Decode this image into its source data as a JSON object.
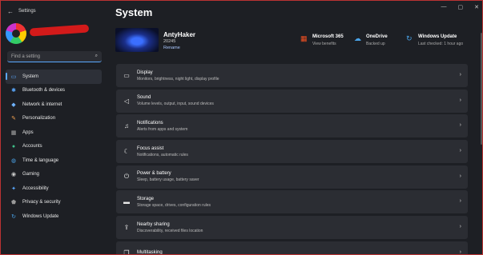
{
  "window": {
    "title": "Settings"
  },
  "sidebar": {
    "search_placeholder": "Find a setting",
    "items": [
      {
        "label": "System",
        "icon": "monitor-icon",
        "glyph": "▭",
        "color": "#5aa9ff",
        "active": true
      },
      {
        "label": "Bluetooth & devices",
        "icon": "bluetooth-icon",
        "glyph": "✱",
        "color": "#5aa9ff"
      },
      {
        "label": "Network & internet",
        "icon": "network-icon",
        "glyph": "◆",
        "color": "#6fb3ff"
      },
      {
        "label": "Personalization",
        "icon": "brush-icon",
        "glyph": "✎",
        "color": "#f0a050"
      },
      {
        "label": "Apps",
        "icon": "apps-icon",
        "glyph": "▦",
        "color": "#aaa"
      },
      {
        "label": "Accounts",
        "icon": "person-icon",
        "glyph": "●",
        "color": "#3fc08a"
      },
      {
        "label": "Time & language",
        "icon": "globe-icon",
        "glyph": "◍",
        "color": "#4aa3e8"
      },
      {
        "label": "Gaming",
        "icon": "gamepad-icon",
        "glyph": "◉",
        "color": "#ccc"
      },
      {
        "label": "Accessibility",
        "icon": "accessibility-icon",
        "glyph": "✦",
        "color": "#5aa9ff"
      },
      {
        "label": "Privacy & security",
        "icon": "shield-icon",
        "glyph": "⬟",
        "color": "#999"
      },
      {
        "label": "Windows Update",
        "icon": "update-icon",
        "glyph": "↻",
        "color": "#4aa3e8"
      }
    ]
  },
  "main": {
    "title": "System",
    "device": {
      "name": "AntyHaker",
      "sub": "20245",
      "rename": "Rename"
    },
    "status": [
      {
        "title": "Microsoft 365",
        "sub": "View benefits",
        "icon": "microsoft365-icon",
        "glyph": "▦",
        "color": "#f25022"
      },
      {
        "title": "OneDrive",
        "sub": "Backed up",
        "icon": "cloud-icon",
        "glyph": "☁",
        "color": "#4aa3e8"
      },
      {
        "title": "Windows Update",
        "sub": "Last checked: 1 hour ago",
        "icon": "update-icon",
        "glyph": "↻",
        "color": "#4aa3e8"
      }
    ],
    "cards": [
      {
        "title": "Display",
        "sub": "Monitors, brightness, night light, display profile",
        "icon": "display-icon",
        "glyph": "▭"
      },
      {
        "title": "Sound",
        "sub": "Volume levels, output, input, sound devices",
        "icon": "speaker-icon",
        "glyph": "◁"
      },
      {
        "title": "Notifications",
        "sub": "Alerts from apps and system",
        "icon": "bell-icon",
        "glyph": "♫"
      },
      {
        "title": "Focus assist",
        "sub": "Notifications, automatic rules",
        "icon": "moon-icon",
        "glyph": "☾"
      },
      {
        "title": "Power & battery",
        "sub": "Sleep, battery usage, battery saver",
        "icon": "power-icon",
        "glyph": "⏻"
      },
      {
        "title": "Storage",
        "sub": "Storage space, drives, configuration rules",
        "icon": "storage-icon",
        "glyph": "▬"
      },
      {
        "title": "Nearby sharing",
        "sub": "Discoverability, received files location",
        "icon": "share-icon",
        "glyph": "⇪"
      },
      {
        "title": "Multitasking",
        "sub": "",
        "icon": "multitask-icon",
        "glyph": "❐"
      }
    ]
  }
}
